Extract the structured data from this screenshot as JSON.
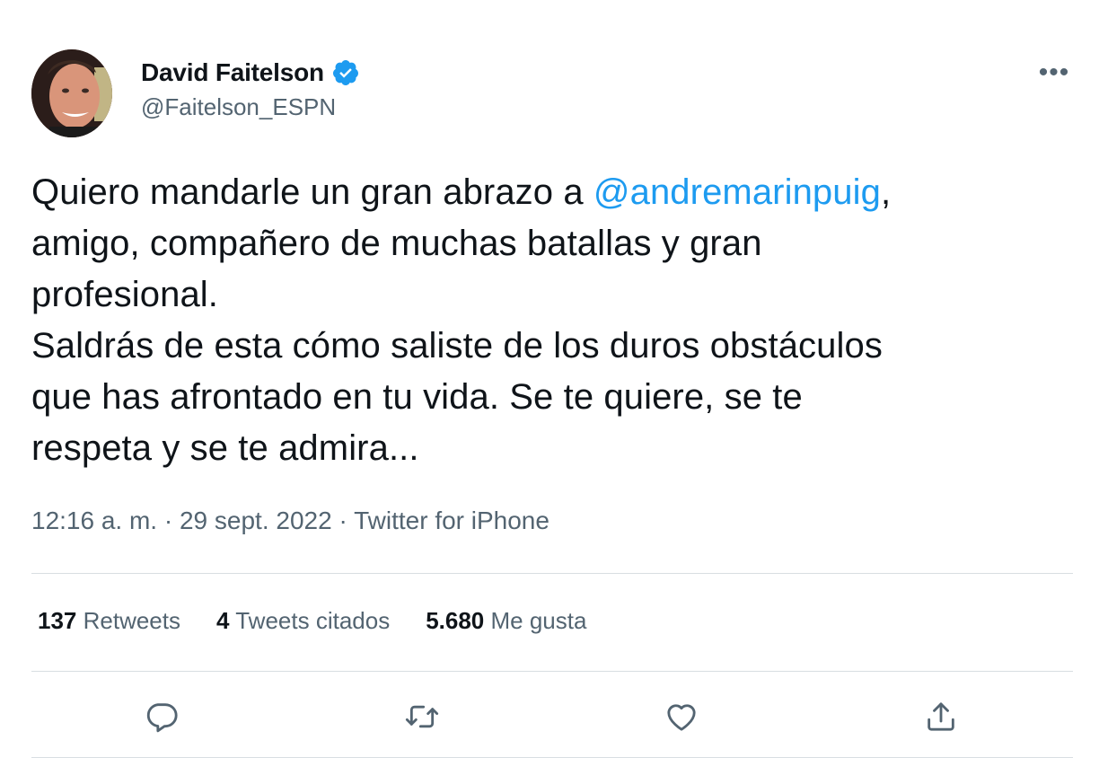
{
  "author": {
    "display_name": "David Faitelson",
    "handle": "@Faitelson_ESPN",
    "verified": true
  },
  "tweet": {
    "lines": [
      {
        "before": "Quiero mandarle un gran abrazo a ",
        "mention": "@andremarinpuig",
        "after": ","
      },
      {
        "text": "amigo, compañero de muchas batallas y gran"
      },
      {
        "text": "profesional."
      },
      {
        "text": "Saldrás de esta cómo saliste de los duros obstáculos"
      },
      {
        "text": "que has afrontado en tu vida. Se te quiere, se te"
      },
      {
        "text": "respeta y se te admira..."
      }
    ]
  },
  "meta": {
    "time": "12:16 a. m.",
    "separator": " · ",
    "date": "29 sept. 2022",
    "source": "Twitter for iPhone"
  },
  "stats": {
    "retweets_count": "137",
    "retweets_label": " Retweets",
    "quotes_count": "4",
    "quotes_label": " Tweets citados",
    "likes_count": "5.680",
    "likes_label": " Me gusta"
  },
  "actions": {
    "reply_icon": "reply-icon",
    "retweet_icon": "retweet-icon",
    "like_icon": "heart-icon",
    "share_icon": "share-icon"
  },
  "colors": {
    "accent": "#1d9bf0",
    "secondary_text": "#536471",
    "primary_text": "#0f1419"
  }
}
